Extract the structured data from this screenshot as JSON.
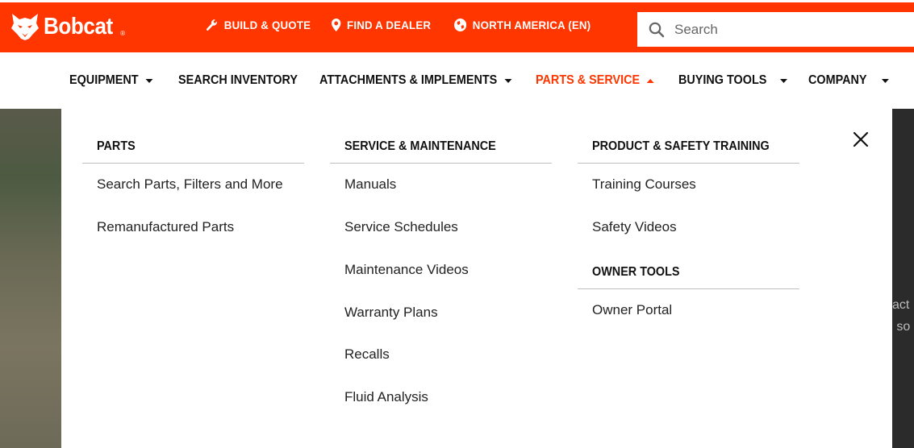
{
  "brand": {
    "name": "Bobcat",
    "reg": "®",
    "color": "#ff3600"
  },
  "utility_nav": {
    "build_quote": "BUILD & QUOTE",
    "find_dealer": "FIND A DEALER",
    "region": "NORTH AMERICA (EN)"
  },
  "search": {
    "placeholder": "Search"
  },
  "main_nav": {
    "equipment": "EQUIPMENT",
    "search_inventory": "SEARCH INVENTORY",
    "attachments": "ATTACHMENTS & IMPLEMENTS",
    "parts_service": "PARTS & SERVICE",
    "buying_tools": "BUYING TOOLS",
    "company": "COMPANY"
  },
  "mega_menu": {
    "parts": {
      "heading": "PARTS",
      "links": [
        "Search Parts, Filters and More",
        "Remanufactured Parts"
      ]
    },
    "service": {
      "heading": "SERVICE & MAINTENANCE",
      "links": [
        "Manuals",
        "Service Schedules",
        "Maintenance Videos",
        "Warranty Plans",
        "Recalls",
        "Fluid Analysis"
      ]
    },
    "training": {
      "heading": "PRODUCT & SAFETY TRAINING",
      "links": [
        "Training Courses",
        "Safety Videos"
      ]
    },
    "owner_tools": {
      "heading": "OWNER TOOLS",
      "links": [
        "Owner Portal"
      ]
    }
  },
  "background_text": [
    "act",
    "d so"
  ]
}
